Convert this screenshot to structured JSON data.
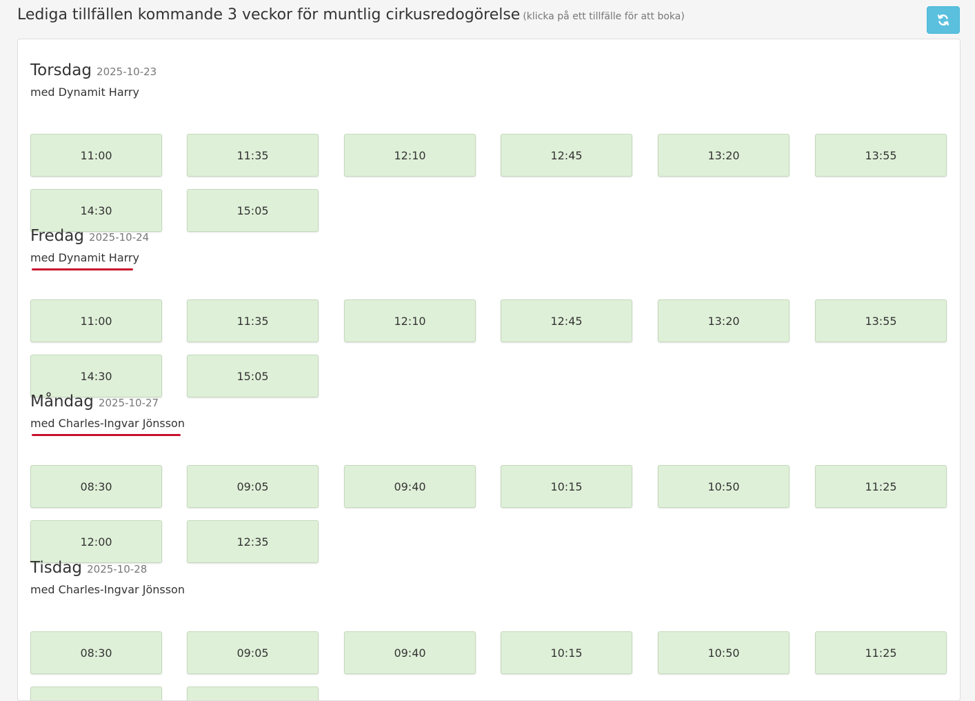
{
  "header": {
    "title": "Lediga tillfällen kommande 3 veckor för muntlig cirkusredogörelse",
    "subtitle": "(klicka på ett tillfälle för att boka)"
  },
  "refresh_button": {
    "icon": "refresh-icon",
    "color": "#5bc0de"
  },
  "slot_color": "#dff0d8",
  "annotation_color": "#c8102e",
  "days": [
    {
      "name": "Torsdag",
      "date": "2025-10-23",
      "teacher": "med Dynamit Harry",
      "underlined": false,
      "slots": [
        "11:00",
        "11:35",
        "12:10",
        "12:45",
        "13:20",
        "13:55",
        "14:30",
        "15:05"
      ]
    },
    {
      "name": "Fredag",
      "date": "2025-10-24",
      "teacher": "med Dynamit Harry",
      "underlined": true,
      "slots": [
        "11:00",
        "11:35",
        "12:10",
        "12:45",
        "13:20",
        "13:55",
        "14:30",
        "15:05"
      ]
    },
    {
      "name": "Måndag",
      "date": "2025-10-27",
      "teacher": "med Charles-Ingvar Jönsson",
      "underlined": true,
      "slots": [
        "08:30",
        "09:05",
        "09:40",
        "10:15",
        "10:50",
        "11:25",
        "12:00",
        "12:35"
      ]
    },
    {
      "name": "Tisdag",
      "date": "2025-10-28",
      "teacher": "med Charles-Ingvar Jönsson",
      "underlined": false,
      "slots": [
        "08:30",
        "09:05",
        "09:40",
        "10:15",
        "10:50",
        "11:25",
        "",
        ""
      ]
    }
  ]
}
